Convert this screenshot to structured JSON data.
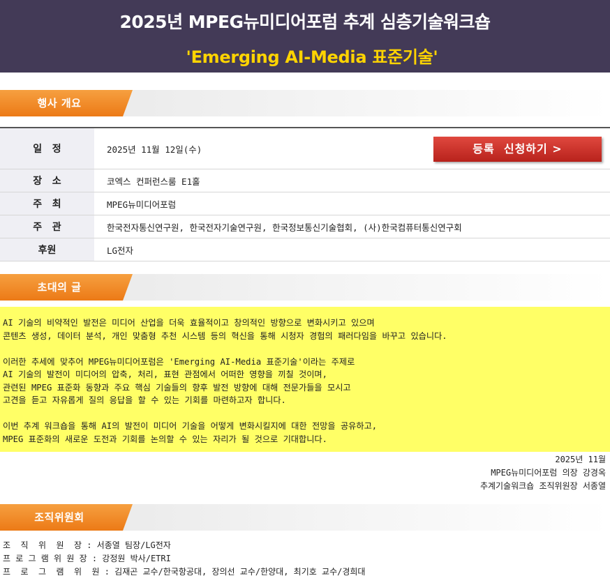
{
  "banner": {
    "title": "2025년 MPEG뉴미디어포럼 추계 심층기술워크숍",
    "subtitle": "'Emerging AI-Media 표준기술'"
  },
  "sections": {
    "overview": "행사 개요",
    "invitation": "초대의 글",
    "committee": "조직위원회"
  },
  "event": {
    "rows": [
      {
        "label": "일   정",
        "value": "2025년 11월 12일(수)"
      },
      {
        "label": "장   소",
        "value": "코엑스 컨퍼런스룸 E1홀"
      },
      {
        "label": "주   최",
        "value": "MPEG뉴미디어포럼"
      },
      {
        "label": "주   관",
        "value": "한국전자통신연구원, 한국전자기술연구원, 한국정보통신기술협회, (사)한국컴퓨터통신연구회"
      },
      {
        "label": "후원",
        "value": "LG전자"
      }
    ],
    "register_label": "등록  신청하기 >"
  },
  "invitation": {
    "p1": [
      "AI 기술의 비약적인 발전은 미디어 산업을 더욱 효율적이고 창의적인 방향으로 변화시키고 있으며",
      "콘텐츠 생성, 데이터 분석, 개인 맞춤형 추천 시스템 등의 혁신을 통해 시청자 경험의 패러다임을 바꾸고 있습니다."
    ],
    "p2": [
      "이러한 추세에 맞추어 MPEG뉴미디어포럼은 'Emerging AI-Media 표준기술'이라는 주제로",
      "AI 기술의 발전이 미디어의 압축, 처리, 표현 관점에서 어떠한 영향을 끼칠 것이며,",
      "관련된 MPEG 표준화 동향과 주요 핵심 기술들의 향후 발전 방향에 대해 전문가들을 모시고",
      "고견을 듣고 자유롭게 질의 응답을 할 수 있는 기회를 마련하고자 합니다."
    ],
    "p3": [
      "이번 추계 워크숍을 통해 AI의 발전이 미디어 기술을 어떻게 변화시킬지에 대한 전망을 공유하고,",
      "MPEG 표준화의 새로운 도전과 기회를 논의할 수 있는 자리가 될 것으로 기대합니다."
    ],
    "date": "2025년 11월",
    "signer1": "MPEG뉴미디어포럼 의장 강경옥",
    "signer2": "추계기술워크숍 조직위원장 서종열"
  },
  "committee": {
    "lines": [
      "조  직  위  원  장 : 서종열 팀장/LG전자",
      "프 로 그 램 위 원 장 : 강정원 박사/ETRI",
      "프  로  그  램  위  원 : 김재곤 교수/한국항공대, 장의선 교수/한양대, 최기호 교수/경희대"
    ]
  }
}
